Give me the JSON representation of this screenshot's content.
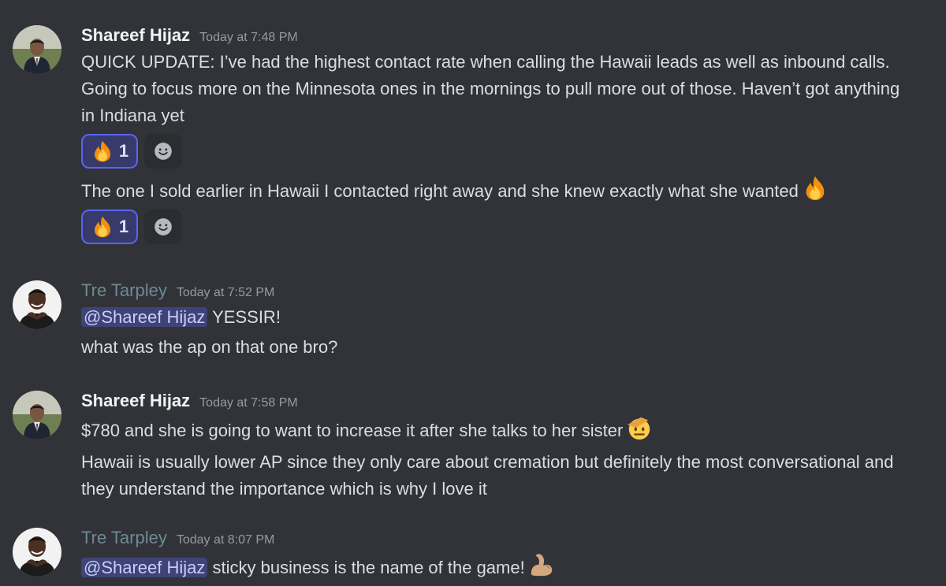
{
  "messages": [
    {
      "author": "Shareef Hijaz",
      "time": "Today at 7:48 PM",
      "lines": [
        "QUICK UPDATE: I’ve had the highest contact rate when calling the Hawaii leads as well as inbound calls. Going to focus more on the Minnesota ones in the mornings to pull more out of those. Haven’t got anything in Indiana yet",
        "The one I sold earlier in Hawaii I contacted right away and she knew exactly what she wanted"
      ],
      "reactions": [
        {
          "emoji": "fire-emoji",
          "count": "1"
        },
        {
          "emoji": "fire-emoji",
          "count": "1"
        }
      ]
    },
    {
      "author": "Tre Tarpley",
      "time": "Today at 7:52 PM",
      "mention": "@Shareef Hijaz",
      "line1_rest": " YESSIR!",
      "line2": "what was the ap on that one bro?"
    },
    {
      "author": "Shareef Hijaz",
      "time": "Today at 7:58 PM",
      "line1": "$780 and she is going to want to increase it after she talks to her sister",
      "line2": "Hawaii is usually lower AP since they only care about cremation but definitely the most conversational and they understand the importance which is why I love it"
    },
    {
      "author": "Tre Tarpley",
      "time": "Today at 8:07 PM",
      "mention": "@Shareef Hijaz",
      "line1_rest": " sticky business is the name of the game!"
    }
  ],
  "icons": {
    "add_reaction": "smile-plus-icon",
    "fire": "fire-emoji",
    "saluting": "saluting-face-emoji",
    "flexed": "flexed-biceps-emoji"
  },
  "colors": {
    "background": "#313338",
    "reaction_border": "#5865f2",
    "mention_bg": "#3c4270"
  }
}
